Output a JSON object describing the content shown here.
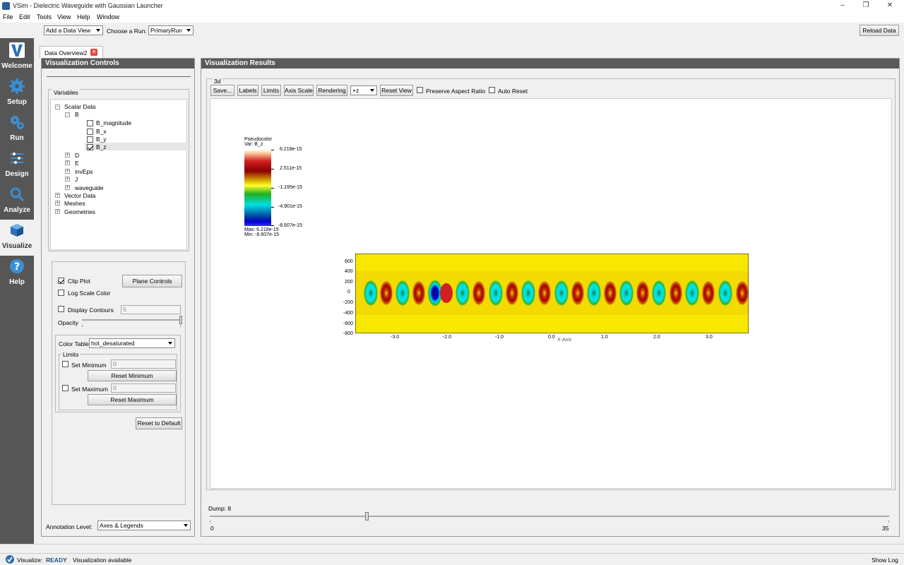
{
  "window": {
    "title": "VSim - Dielectric Waveguide with Gaussian Launcher"
  },
  "menu": [
    "File",
    "Edit",
    "Tools",
    "View",
    "Help",
    "Window"
  ],
  "toolbar": {
    "add_view": "Add a Data View",
    "choose_run_label": "Choose a Run:",
    "run_value": "PrimaryRun",
    "reload": "Reload Data"
  },
  "tab": {
    "label": "Data Overview2"
  },
  "sidebar": [
    {
      "label": "Welcome",
      "icon": "vsim-logo-icon"
    },
    {
      "label": "Setup",
      "icon": "gear-icon"
    },
    {
      "label": "Run",
      "icon": "gears-icon"
    },
    {
      "label": "Design",
      "icon": "design-icon"
    },
    {
      "label": "Analyze",
      "icon": "magnifier-icon"
    },
    {
      "label": "Visualize",
      "icon": "cube-icon"
    },
    {
      "label": "Help",
      "icon": "help-icon"
    }
  ],
  "controls": {
    "header": "Visualization Controls",
    "variables_label": "Variables",
    "tree": {
      "scalar": "Scalar Data",
      "b": "B",
      "b_items": [
        {
          "label": "B_magnitude",
          "checked": false
        },
        {
          "label": "B_x",
          "checked": false
        },
        {
          "label": "B_y",
          "checked": false
        },
        {
          "label": "B_z",
          "checked": true
        }
      ],
      "others": [
        "D",
        "E",
        "invEps",
        "J",
        "waveguide"
      ],
      "top": [
        "Vector Data",
        "Meshes",
        "Geometries"
      ]
    },
    "clip_plot": "Clip Plot",
    "plane_controls": "Plane Controls",
    "log_scale": "Log Scale Color",
    "display_contours": "Display Contours",
    "contours_value": "5",
    "opacity": "Opacity",
    "color_table_label": "Color Table",
    "color_table_value": "hot_desaturated",
    "limits": "Limits",
    "set_min": "Set Minimum",
    "min_value": "0",
    "reset_min": "Reset Minimum",
    "set_max": "Set Maximum",
    "max_value": "0",
    "reset_max": "Reset Maximum",
    "reset_default": "Reset to Default",
    "annotation_label": "Annotation Level:",
    "annotation_value": "Axes & Legends"
  },
  "results": {
    "header": "Visualization Results",
    "group": "3d",
    "buttons": {
      "save": "Save...",
      "labels": "Labels",
      "limits": "Limits",
      "axis_scale": "Axis Scale",
      "rendering": "Rendering",
      "view_axis": "+z",
      "reset_view": "Reset View"
    },
    "preserve": "Preserve Aspect Ratio",
    "auto_reset": "Auto Reset",
    "legend": {
      "title": "Pseudocolor",
      "var": "Var: B_z",
      "ticks": [
        "6.218e-15",
        "2.511e-15",
        "-1.195e-15",
        "-4.901e-15",
        "-8.607e-15"
      ],
      "max": "Max:  6.218e-15",
      "min": "Min: -8.607e-15"
    },
    "yticks": [
      "600",
      "400",
      "200",
      "0",
      "-200",
      "-400",
      "-600",
      "-800"
    ],
    "xticks": [
      "-3.0",
      "-2.0",
      "-1.0",
      "0.0",
      "1.0",
      "2.0",
      "3.0"
    ],
    "xaxis_label": "X-Axis",
    "dump_label": "Dump: 8",
    "dump_value": 8,
    "dump_min": "0",
    "dump_max": "35"
  },
  "status": {
    "label": "Visualize:",
    "state": "READY",
    "message": "Visualization available",
    "show_log": "Show Log"
  }
}
